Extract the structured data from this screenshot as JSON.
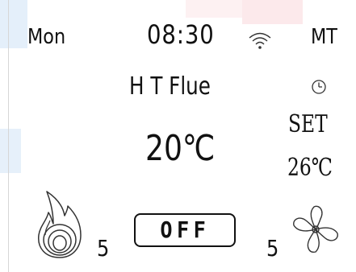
{
  "header": {
    "day": "Mon",
    "time": "08:30",
    "mode": "MT"
  },
  "main": {
    "title": "H T Flue",
    "temperature": "20℃"
  },
  "setpoint": {
    "label": "SET",
    "value": "26℃"
  },
  "controls": {
    "power_label": "OFF",
    "flame_level": "5",
    "fan_level": "5"
  },
  "icons": {
    "wifi": "wifi-icon",
    "clock": "clock-icon",
    "flame": "flame-icon",
    "fan": "fan-icon"
  }
}
